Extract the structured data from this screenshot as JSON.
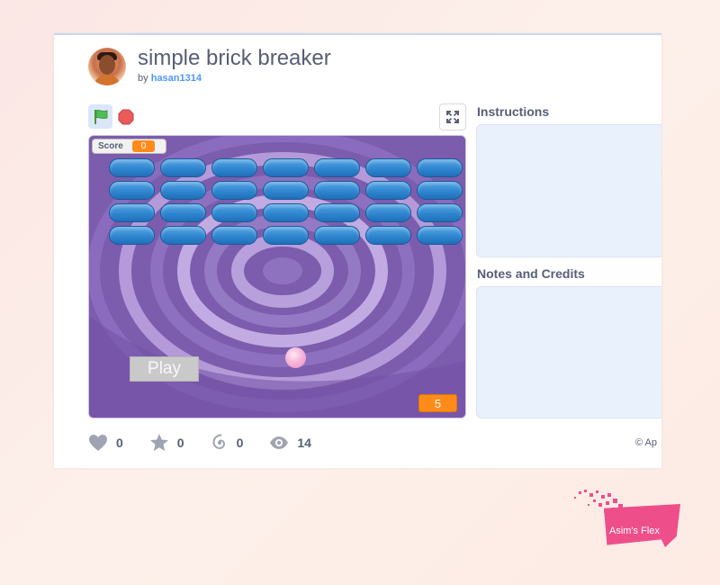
{
  "project": {
    "title": "simple brick breaker",
    "by_prefix": "by",
    "author": "hasan1314"
  },
  "stage": {
    "score_label": "Score",
    "score_value": "0",
    "play_label": "Play",
    "lives_value": "5",
    "brick_rows": 4,
    "brick_cols": 7
  },
  "sidebar": {
    "instructions_title": "Instructions",
    "notes_title": "Notes and Credits"
  },
  "stats": {
    "loves": "0",
    "favorites": "0",
    "remixes": "0",
    "views": "14"
  },
  "footer": {
    "copyright_partial": "© Ap"
  },
  "watermark": {
    "text": "Asim's Flex"
  },
  "icons": {
    "green_flag": "green-flag-icon",
    "stop": "stop-icon",
    "fullscreen": "fullscreen-icon",
    "heart": "heart-icon",
    "star": "star-icon",
    "remix": "remix-icon",
    "eye": "eye-icon"
  },
  "colors": {
    "stage_purple": "#7c5cad",
    "brick_blue": "#2f86cf",
    "monitor_orange": "#ff8c1a",
    "panel_bg": "#e9f1fc",
    "text": "#575e75",
    "link": "#4d97ff",
    "watermark_pink": "#ee4f8a"
  }
}
